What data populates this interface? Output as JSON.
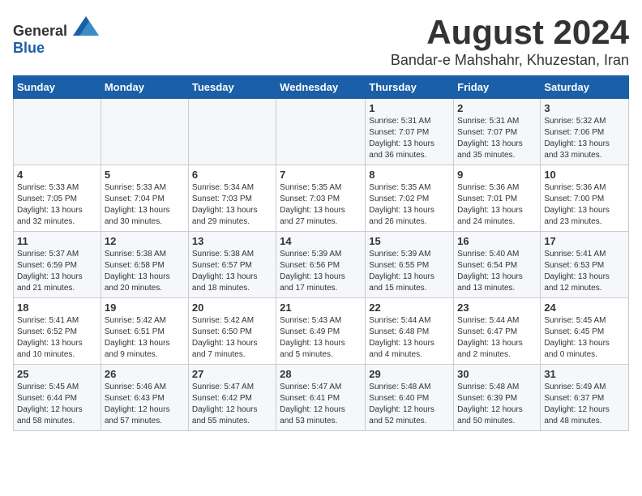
{
  "logo": {
    "general": "General",
    "blue": "Blue"
  },
  "title": "August 2024",
  "subtitle": "Bandar-e Mahshahr, Khuzestan, Iran",
  "days_of_week": [
    "Sunday",
    "Monday",
    "Tuesday",
    "Wednesday",
    "Thursday",
    "Friday",
    "Saturday"
  ],
  "weeks": [
    [
      {
        "day": "",
        "content": ""
      },
      {
        "day": "",
        "content": ""
      },
      {
        "day": "",
        "content": ""
      },
      {
        "day": "",
        "content": ""
      },
      {
        "day": "1",
        "content": "Sunrise: 5:31 AM\nSunset: 7:07 PM\nDaylight: 13 hours\nand 36 minutes."
      },
      {
        "day": "2",
        "content": "Sunrise: 5:31 AM\nSunset: 7:07 PM\nDaylight: 13 hours\nand 35 minutes."
      },
      {
        "day": "3",
        "content": "Sunrise: 5:32 AM\nSunset: 7:06 PM\nDaylight: 13 hours\nand 33 minutes."
      }
    ],
    [
      {
        "day": "4",
        "content": "Sunrise: 5:33 AM\nSunset: 7:05 PM\nDaylight: 13 hours\nand 32 minutes."
      },
      {
        "day": "5",
        "content": "Sunrise: 5:33 AM\nSunset: 7:04 PM\nDaylight: 13 hours\nand 30 minutes."
      },
      {
        "day": "6",
        "content": "Sunrise: 5:34 AM\nSunset: 7:03 PM\nDaylight: 13 hours\nand 29 minutes."
      },
      {
        "day": "7",
        "content": "Sunrise: 5:35 AM\nSunset: 7:03 PM\nDaylight: 13 hours\nand 27 minutes."
      },
      {
        "day": "8",
        "content": "Sunrise: 5:35 AM\nSunset: 7:02 PM\nDaylight: 13 hours\nand 26 minutes."
      },
      {
        "day": "9",
        "content": "Sunrise: 5:36 AM\nSunset: 7:01 PM\nDaylight: 13 hours\nand 24 minutes."
      },
      {
        "day": "10",
        "content": "Sunrise: 5:36 AM\nSunset: 7:00 PM\nDaylight: 13 hours\nand 23 minutes."
      }
    ],
    [
      {
        "day": "11",
        "content": "Sunrise: 5:37 AM\nSunset: 6:59 PM\nDaylight: 13 hours\nand 21 minutes."
      },
      {
        "day": "12",
        "content": "Sunrise: 5:38 AM\nSunset: 6:58 PM\nDaylight: 13 hours\nand 20 minutes."
      },
      {
        "day": "13",
        "content": "Sunrise: 5:38 AM\nSunset: 6:57 PM\nDaylight: 13 hours\nand 18 minutes."
      },
      {
        "day": "14",
        "content": "Sunrise: 5:39 AM\nSunset: 6:56 PM\nDaylight: 13 hours\nand 17 minutes."
      },
      {
        "day": "15",
        "content": "Sunrise: 5:39 AM\nSunset: 6:55 PM\nDaylight: 13 hours\nand 15 minutes."
      },
      {
        "day": "16",
        "content": "Sunrise: 5:40 AM\nSunset: 6:54 PM\nDaylight: 13 hours\nand 13 minutes."
      },
      {
        "day": "17",
        "content": "Sunrise: 5:41 AM\nSunset: 6:53 PM\nDaylight: 13 hours\nand 12 minutes."
      }
    ],
    [
      {
        "day": "18",
        "content": "Sunrise: 5:41 AM\nSunset: 6:52 PM\nDaylight: 13 hours\nand 10 minutes."
      },
      {
        "day": "19",
        "content": "Sunrise: 5:42 AM\nSunset: 6:51 PM\nDaylight: 13 hours\nand 9 minutes."
      },
      {
        "day": "20",
        "content": "Sunrise: 5:42 AM\nSunset: 6:50 PM\nDaylight: 13 hours\nand 7 minutes."
      },
      {
        "day": "21",
        "content": "Sunrise: 5:43 AM\nSunset: 6:49 PM\nDaylight: 13 hours\nand 5 minutes."
      },
      {
        "day": "22",
        "content": "Sunrise: 5:44 AM\nSunset: 6:48 PM\nDaylight: 13 hours\nand 4 minutes."
      },
      {
        "day": "23",
        "content": "Sunrise: 5:44 AM\nSunset: 6:47 PM\nDaylight: 13 hours\nand 2 minutes."
      },
      {
        "day": "24",
        "content": "Sunrise: 5:45 AM\nSunset: 6:45 PM\nDaylight: 13 hours\nand 0 minutes."
      }
    ],
    [
      {
        "day": "25",
        "content": "Sunrise: 5:45 AM\nSunset: 6:44 PM\nDaylight: 12 hours\nand 58 minutes."
      },
      {
        "day": "26",
        "content": "Sunrise: 5:46 AM\nSunset: 6:43 PM\nDaylight: 12 hours\nand 57 minutes."
      },
      {
        "day": "27",
        "content": "Sunrise: 5:47 AM\nSunset: 6:42 PM\nDaylight: 12 hours\nand 55 minutes."
      },
      {
        "day": "28",
        "content": "Sunrise: 5:47 AM\nSunset: 6:41 PM\nDaylight: 12 hours\nand 53 minutes."
      },
      {
        "day": "29",
        "content": "Sunrise: 5:48 AM\nSunset: 6:40 PM\nDaylight: 12 hours\nand 52 minutes."
      },
      {
        "day": "30",
        "content": "Sunrise: 5:48 AM\nSunset: 6:39 PM\nDaylight: 12 hours\nand 50 minutes."
      },
      {
        "day": "31",
        "content": "Sunrise: 5:49 AM\nSunset: 6:37 PM\nDaylight: 12 hours\nand 48 minutes."
      }
    ]
  ]
}
